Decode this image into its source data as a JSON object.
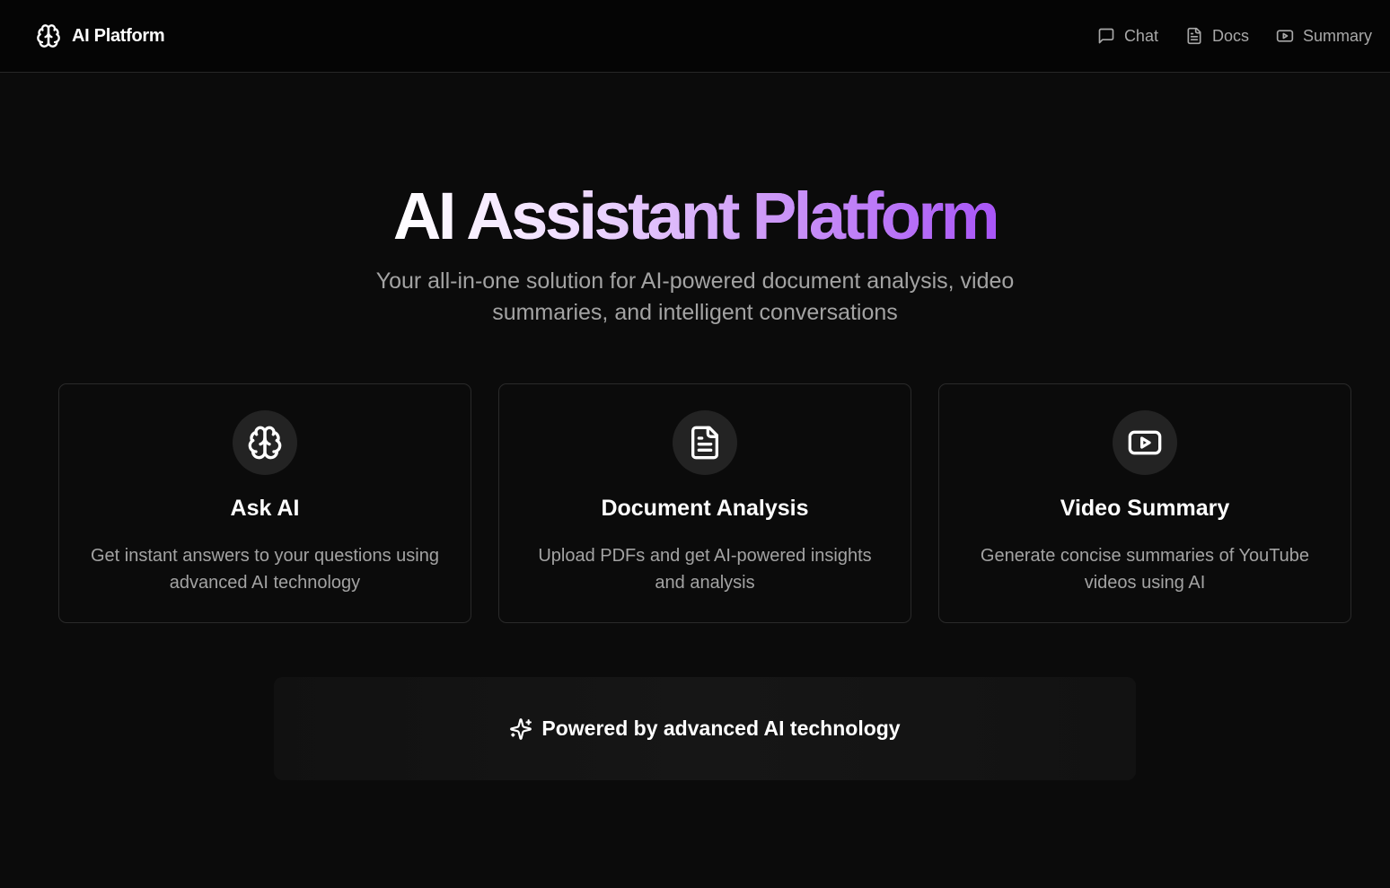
{
  "header": {
    "brand_name": "AI Platform",
    "brand_icon": "brain-icon",
    "nav": [
      {
        "label": "Chat",
        "icon": "message-square-icon"
      },
      {
        "label": "Docs",
        "icon": "file-text-icon"
      },
      {
        "label": "Summary",
        "icon": "youtube-icon"
      }
    ]
  },
  "hero": {
    "title": "AI Assistant Platform",
    "subtitle": "Your all-in-one solution for AI-powered document analysis, video summaries, and intelligent conversations"
  },
  "cards": [
    {
      "icon": "brain-icon",
      "title": "Ask AI",
      "description": "Get instant answers to your questions using advanced AI technology"
    },
    {
      "icon": "file-text-icon",
      "title": "Document Analysis",
      "description": "Upload PDFs and get AI-powered insights and analysis"
    },
    {
      "icon": "youtube-icon",
      "title": "Video Summary",
      "description": "Generate concise summaries of YouTube videos using AI"
    }
  ],
  "footer_banner": {
    "icon": "sparkles-icon",
    "text": "Powered by advanced AI technology"
  },
  "colors": {
    "background": "#0b0b0b",
    "topbar": "#050505",
    "accent_purple": "#a855f7",
    "muted_text": "#a3a3a3",
    "card_border": "#2a2a2a",
    "icon_circle": "#232323"
  }
}
